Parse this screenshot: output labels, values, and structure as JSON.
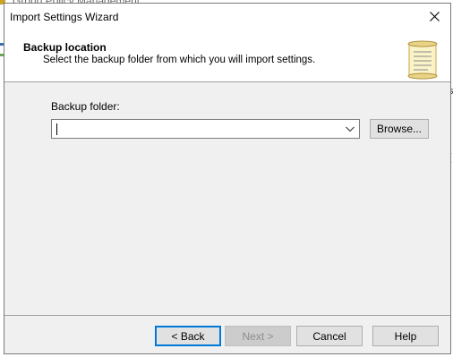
{
  "background_app": {
    "title": "Group Policy Management",
    "right_fragments": [
      "s",
      "l",
      "("
    ]
  },
  "dialog": {
    "title": "Import Settings Wizard",
    "header": {
      "title": "Backup location",
      "subtitle": "Select the backup folder from which you will import settings."
    },
    "backup_folder": {
      "label": "Backup folder:",
      "value": ""
    },
    "browse_label": "Browse...",
    "buttons": {
      "back": "< Back",
      "next": "Next >",
      "cancel": "Cancel",
      "help": "Help"
    }
  },
  "colors": {
    "dialog_bg": "#f0f0f0",
    "focus_border": "#0078d7"
  },
  "icons": [
    "close-icon",
    "scroll-icon",
    "chevron-down-icon"
  ]
}
